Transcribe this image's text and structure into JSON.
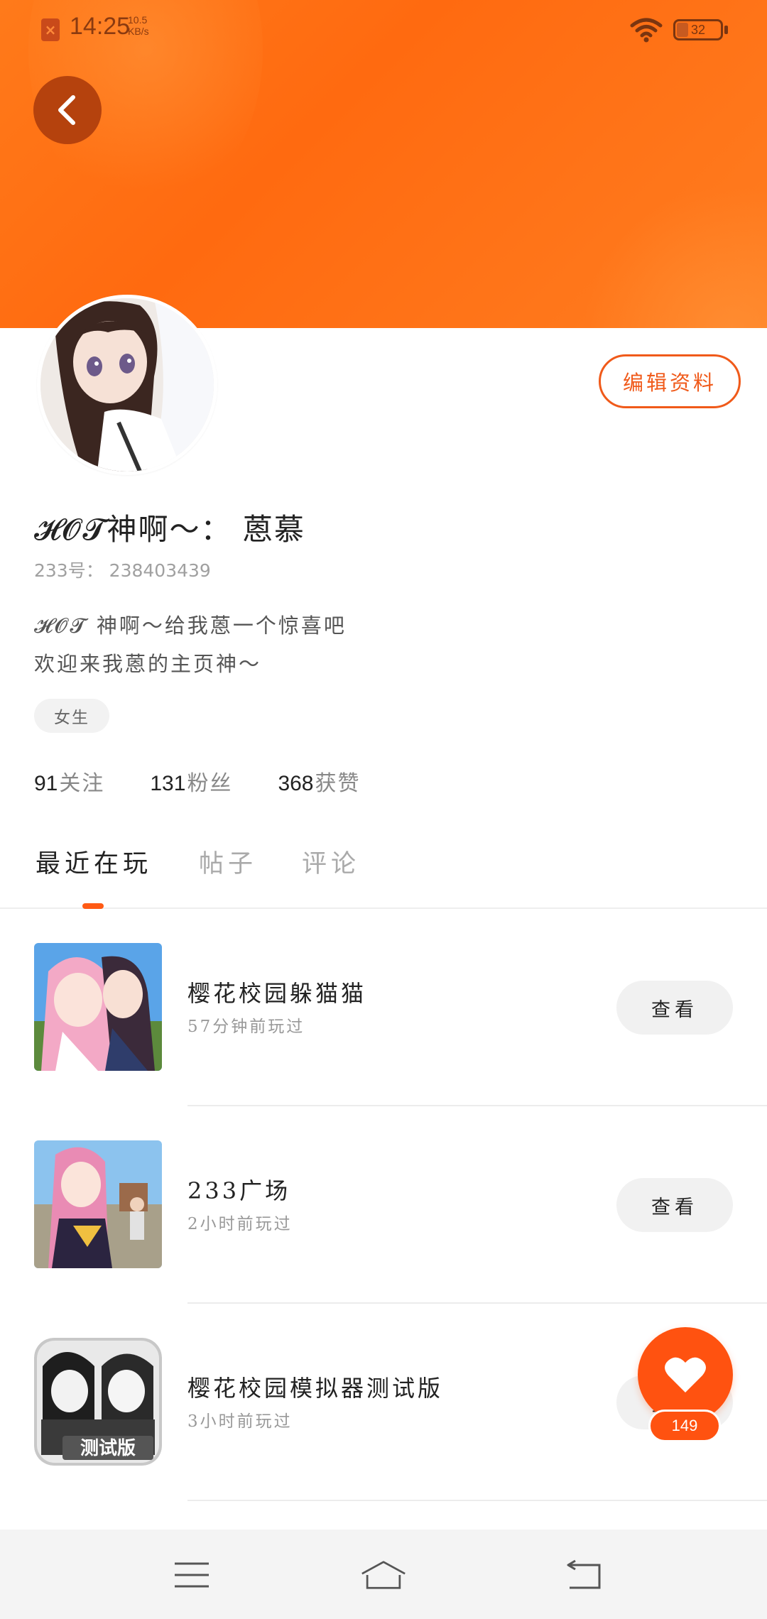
{
  "status_bar": {
    "time": "14:25",
    "net_speed_value": "10.5",
    "net_speed_unit": "KB/s",
    "battery_level": "32"
  },
  "profile": {
    "edit_label": "编辑资料",
    "name": "𝓗𝓞𝓣神啊～： 蒽慕",
    "uid_text": "233号： 238403439",
    "bio_line1": "𝓗𝓞𝓣 神啊～给我蒽一个惊喜吧",
    "bio_line2": "欢迎来我蒽的主页神～",
    "gender_tag": "女生"
  },
  "stats": [
    {
      "value": "91",
      "label": "关注"
    },
    {
      "value": "131",
      "label": "粉丝"
    },
    {
      "value": "368",
      "label": "获赞"
    }
  ],
  "tabs": [
    {
      "label": "最近在玩",
      "active": true
    },
    {
      "label": "帖子",
      "active": false
    },
    {
      "label": "评论",
      "active": false
    }
  ],
  "games": [
    {
      "title": "樱花校园躲猫猫",
      "played": "57分钟前玩过",
      "action": "查看"
    },
    {
      "title": "233广场",
      "played": "2小时前玩过",
      "action": "查看"
    },
    {
      "title": "樱花校园模拟器测试版",
      "played": "3小时前玩过",
      "action": "查看",
      "badge": "测试版"
    }
  ],
  "like": {
    "count": "149"
  },
  "colors": {
    "accent": "#ff5a14",
    "banner": "#ff7a1a"
  }
}
